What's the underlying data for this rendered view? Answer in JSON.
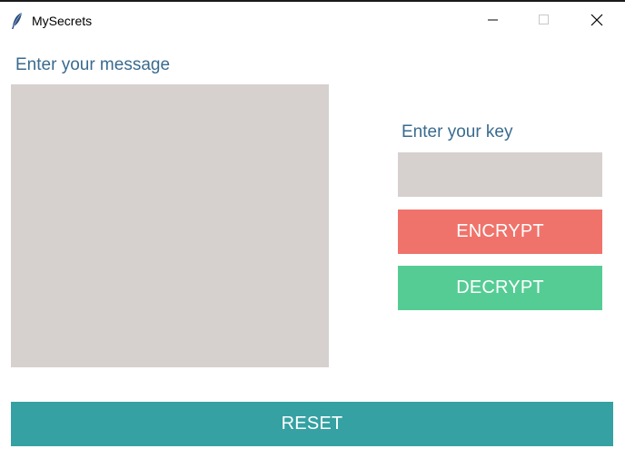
{
  "window": {
    "title": "MySecrets",
    "icon": "feather-icon",
    "controls": [
      "minimize-icon",
      "maximize-icon",
      "close-icon"
    ]
  },
  "message": {
    "label": "Enter your message",
    "value": ""
  },
  "key": {
    "label": "Enter your key",
    "value": ""
  },
  "buttons": {
    "encrypt": "ENCRYPT",
    "decrypt": "DECRYPT",
    "reset": "RESET"
  },
  "colors": {
    "input_bg": "#d6d1ce",
    "label_text": "#3a6b8f",
    "encrypt": "#f0736b",
    "decrypt": "#56cc95",
    "reset": "#35a1a3"
  }
}
